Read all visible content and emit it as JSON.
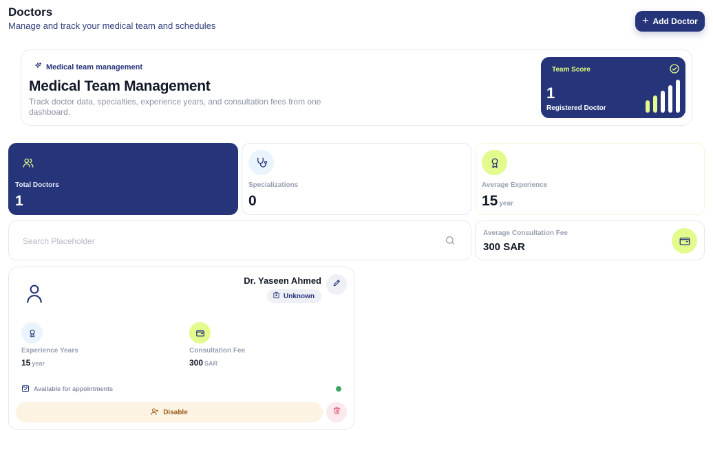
{
  "header": {
    "title": "Doctors",
    "subtitle": "Manage and track your medical team and schedules",
    "add_button_label": "Add Doctor"
  },
  "hero": {
    "tag": "Medical team management",
    "title": "Medical Team Management",
    "description": "Track doctor data, specialties, experience years, and consultation fees from one dashboard.",
    "score": {
      "label": "Team Score",
      "value": "1",
      "sublabel": "Registered Doctor"
    }
  },
  "stats": [
    {
      "label": "Total Doctors",
      "value": "1",
      "unit": "",
      "icon": "users-icon"
    },
    {
      "label": "Specializations",
      "value": "0",
      "unit": "",
      "icon": "stethoscope-icon"
    },
    {
      "label": "Average Experience",
      "value": "15",
      "unit": "year",
      "icon": "award-icon"
    }
  ],
  "search": {
    "placeholder": "Search Placeholder",
    "value": ""
  },
  "fee_stat": {
    "label": "Average Consultation Fee",
    "value": "300 SAR",
    "icon": "wallet-icon"
  },
  "doctors": [
    {
      "name": "Dr. Yaseen Ahmed",
      "department": "Unknown",
      "experience_label": "Experience Years",
      "experience_value": "15",
      "experience_unit": "year",
      "fee_label": "Consultation Fee",
      "fee_value": "300",
      "fee_unit": "SAR",
      "availability": "Available for appointments",
      "disable_label": "Disable"
    }
  ],
  "colors": {
    "primary": "#26357a",
    "accent": "#e3fa8d",
    "available": "#3fa66b",
    "danger": "#e0607e",
    "warning_bg": "#fdf3e3"
  }
}
